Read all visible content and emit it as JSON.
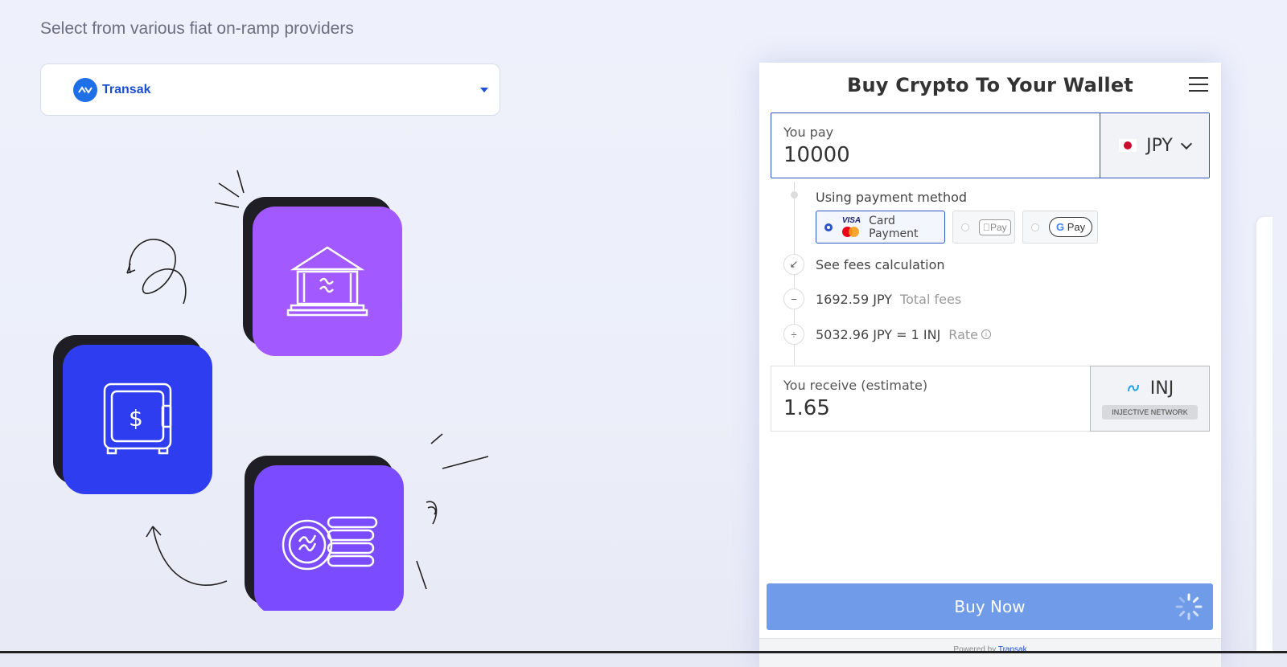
{
  "left": {
    "subtitle": "Select from various fiat on-ramp providers",
    "provider": {
      "name": "Transak",
      "icon": "transak-logo-icon"
    }
  },
  "widget": {
    "title": "Buy Crypto To Your Wallet",
    "pay": {
      "label": "You pay",
      "value": "10000",
      "currency": "JPY"
    },
    "payment_method": {
      "label": "Using payment method",
      "options": [
        {
          "label": "Card Payment",
          "brand": "VISA",
          "selected": true
        },
        {
          "label": "Pay",
          "brand": "apple-pay",
          "selected": false
        },
        {
          "label": "Pay",
          "brand": "google-pay",
          "selected": false
        }
      ]
    },
    "fees_link": "See fees calculation",
    "total_fees": {
      "value": "1692.59 JPY",
      "label": "Total fees"
    },
    "rate": {
      "value": "5032.96 JPY = 1 INJ",
      "label": "Rate"
    },
    "receive": {
      "label": "You receive (estimate)",
      "value": "1.65",
      "crypto": "INJ",
      "network": "INJECTIVE NETWORK"
    },
    "buy_button": "Buy Now",
    "powered_by": "Powered by",
    "powered_brand": "Transak"
  },
  "colors": {
    "accent": "#2d55c9",
    "buy_button": "#6f9be8",
    "purple_tile": "#a259ff",
    "blue_tile": "#2f3df0",
    "violet_tile": "#7a4bff"
  }
}
